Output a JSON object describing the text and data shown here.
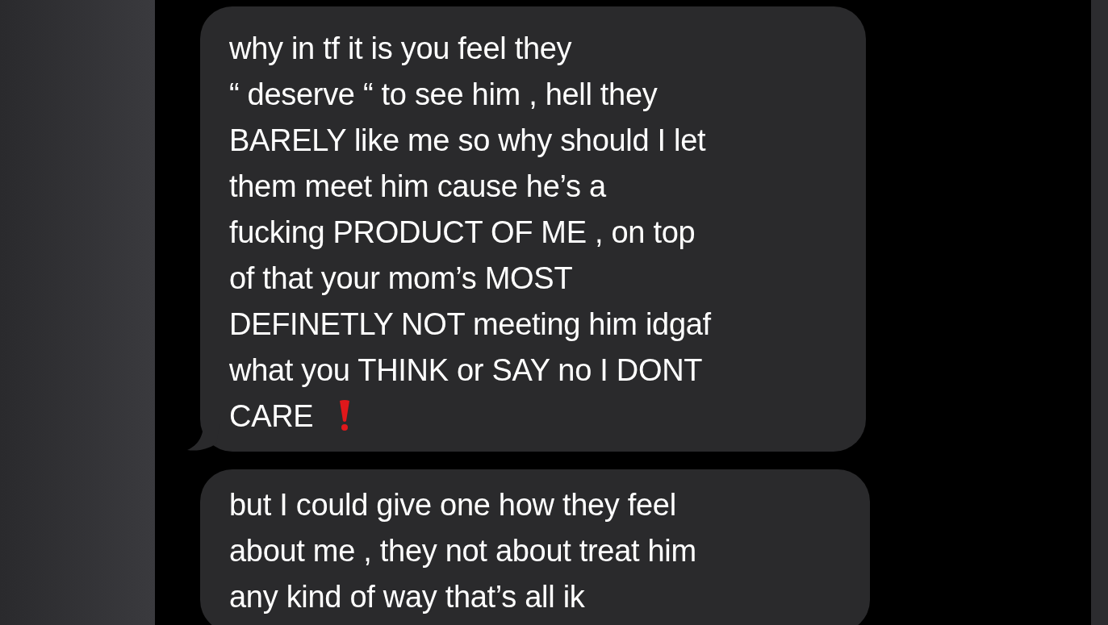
{
  "messages": [
    {
      "lines": [
        "why in tf it is you feel they",
        "“ deserve “ to see him , hell they",
        "BARELY like me so why should I let",
        "them meet him cause he’s a",
        "fucking PRODUCT OF ME , on top",
        "of that your mom’s MOST",
        "DEFINETLY NOT meeting him idgaf",
        "what you THINK or SAY no I DONT",
        "CARE"
      ],
      "alert_mark": true,
      "tail": true
    },
    {
      "lines": [
        "but I could give one how they feel",
        "about me , they not about treat him",
        "any kind of way that’s all ik"
      ],
      "alert_mark": false,
      "tail": false
    }
  ]
}
